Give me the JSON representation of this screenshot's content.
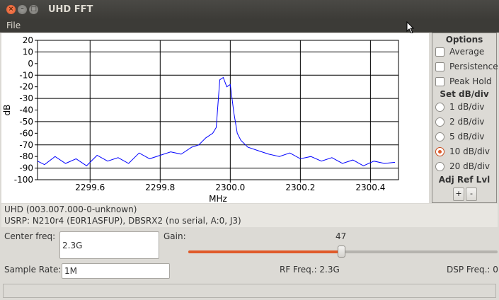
{
  "window": {
    "title": "UHD FFT"
  },
  "menu": {
    "file": "File"
  },
  "chart_data": {
    "type": "line",
    "xlabel": "MHz",
    "ylabel": "dB",
    "xlim": [
      2299.45,
      2300.48
    ],
    "ylim": [
      -100,
      20
    ],
    "x_ticks": [
      "2299.6",
      "2299.8",
      "2300.0",
      "2300.2",
      "2300.4"
    ],
    "x_tick_values": [
      2299.6,
      2299.8,
      2300.0,
      2300.2,
      2300.4
    ],
    "y_ticks": [
      20,
      10,
      0,
      -10,
      -20,
      -30,
      -40,
      -50,
      -60,
      -70,
      -80,
      -90,
      -100
    ],
    "grid": true,
    "line_color": "#0000ff",
    "series": [
      {
        "x": [
          2299.45,
          2299.47,
          2299.5,
          2299.53,
          2299.56,
          2299.59,
          2299.62,
          2299.65,
          2299.68,
          2299.71,
          2299.74,
          2299.77,
          2299.8,
          2299.83,
          2299.86,
          2299.89,
          2299.91,
          2299.93,
          2299.95,
          2299.96,
          2299.97,
          2299.98,
          2299.99,
          2300.0,
          2300.01,
          2300.02,
          2300.03,
          2300.05,
          2300.08,
          2300.11,
          2300.14,
          2300.17,
          2300.2,
          2300.23,
          2300.26,
          2300.29,
          2300.32,
          2300.35,
          2300.38,
          2300.41,
          2300.44,
          2300.47
        ],
        "y": [
          -84,
          -87,
          -80,
          -86,
          -82,
          -88,
          -79,
          -84,
          -81,
          -86,
          -77,
          -82,
          -79,
          -76,
          -78,
          -72,
          -70,
          -64,
          -60,
          -55,
          -14,
          -12,
          -20,
          -18,
          -42,
          -60,
          -66,
          -72,
          -75,
          -78,
          -80,
          -77,
          -82,
          -80,
          -84,
          -81,
          -86,
          -83,
          -88,
          -84,
          -86,
          -85
        ]
      }
    ]
  },
  "options": {
    "title": "Options",
    "average": "Average",
    "persistence": "Persistence",
    "peak_hold": "Peak Hold",
    "set_db_div": "Set dB/div",
    "div_options": [
      "1 dB/div",
      "2 dB/div",
      "5 dB/div",
      "10 dB/div",
      "20 dB/div"
    ],
    "selected_div": "10 dB/div",
    "adj_ref_lvl": "Adj Ref Lvl",
    "plus": "+",
    "minus": "-"
  },
  "info": {
    "uhd_version": "UHD (003.007.000-0-unknown)",
    "usrp": "USRP: N210r4 (E0R1ASFUP), DBSRX2 (no serial, A:0, J3)"
  },
  "controls": {
    "center_freq_label": "Center freq:",
    "center_freq_value": "2.3G",
    "gain_label": "Gain:",
    "gain_value": "47",
    "gain_fraction": 0.494,
    "sample_rate_label": "Sample Rate:",
    "sample_rate_value": "1M",
    "rf_freq": "RF Freq.: 2.3G",
    "dsp_freq": "DSP Freq.: 0"
  }
}
